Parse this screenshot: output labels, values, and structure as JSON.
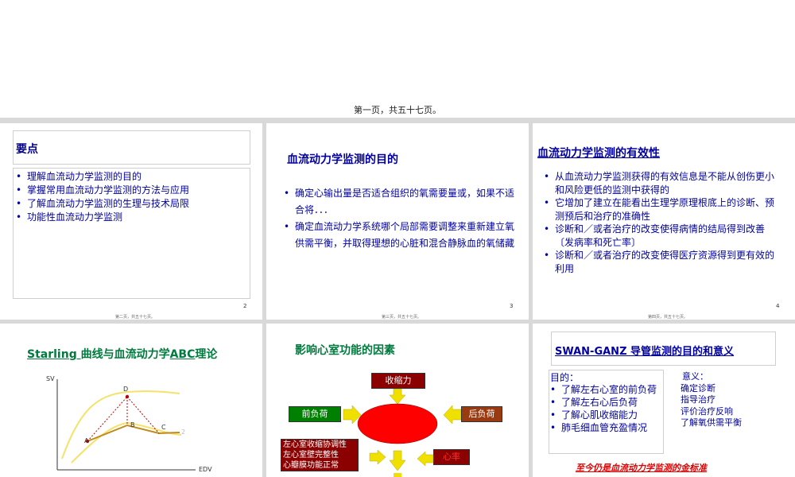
{
  "header": {
    "caption": "第一页，共五十七页。"
  },
  "slide2": {
    "title": "要点",
    "bullets": [
      "理解血流动力学监测的目的",
      "掌握常用血流动力学监测的方法与应用",
      "了解血流动力学监测的生理与技术局限",
      "功能性血流动力学监测"
    ],
    "page_number": "2",
    "footer": "第二页，共五十七页。"
  },
  "slide3": {
    "title": "血流动力学监测的目的",
    "bullets": [
      "确定心输出量是否适合组织的氧需要量或，如果不适合将．．．",
      "确定血流动力学系统哪个局部需要调整来重新建立氧供需平衡，并取得理想的心脏和混合静脉血的氧储藏"
    ],
    "page_number": "3",
    "footer": "第三页，共五十七页。"
  },
  "slide4": {
    "title": "血流动力学监测的有效性",
    "bullets": [
      "从血流动力学监测获得的有效信息是不能从创伤更小和风险更低的监测中获得的",
      "它增加了建立在能看出生理学原理根底上的诊断、预测预后和治疗的准确性",
      "诊断和／或者治疗的改变使得病情的结局得到改善〔发病率和死亡率〕",
      "诊断和／或者治疗的改变使得医疗资源得到更有效的利用"
    ],
    "page_number": "4",
    "footer": "第四页，共五十七页。"
  },
  "slide5": {
    "title_part1": "Starling ",
    "title_part2": "曲线与血流动力学",
    "title_part3": "ABC",
    "title_part4": "理论",
    "y_axis_label": "SV",
    "x_axis_label": "EDV",
    "point_a": "A",
    "point_b": "B",
    "point_c": "C",
    "point_d": "D",
    "curve_label": "2"
  },
  "slide6": {
    "title": "影响心室功能的因素",
    "top_box": "收缩力",
    "left_box": "前负荷",
    "right_box": "后负荷",
    "bottom_left_box": [
      "左心室收缩协调性",
      "左心室壁完整性",
      "心瓣膜功能正常"
    ],
    "bottom_right_box": "心率",
    "colors": {
      "dark_red": "#8b0000",
      "green": "#008000",
      "brown": "#9a3a10",
      "center": "#ff0000",
      "arrow": "#f0e000"
    }
  },
  "slide7": {
    "title": "SWAN-GANZ 导管监测的目的和意义",
    "purpose_heading": "目的：",
    "purpose_items": [
      "了解左右心室的前负荷",
      "了解左右心后负荷",
      "了解心肌收缩能力",
      "肺毛细血管充盈情况"
    ],
    "meaning_heading": "意义：",
    "meaning_items": [
      "确定诊断",
      "指导治疗",
      "评价治疗反响",
      "了解氧供需平衡"
    ],
    "footnote": "至今仍是血流动力学监测的金标准"
  }
}
